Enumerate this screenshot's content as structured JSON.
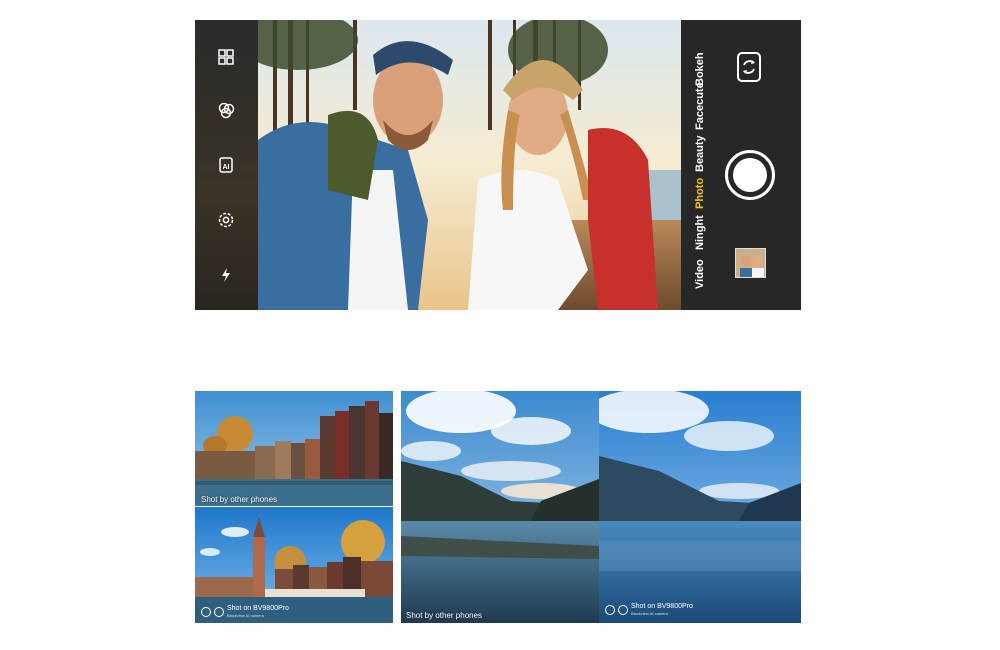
{
  "camera": {
    "modes": [
      "Video",
      "Ninght",
      "Photo",
      "Beauty",
      "Facecute",
      "Bokeh"
    ],
    "active_mode": "Photo",
    "left_icons": [
      "grid-icon",
      "filter-icon",
      "ai-icon",
      "settings-icon",
      "flash-icon"
    ],
    "switch_icon": "switch-camera-icon",
    "accent_color": "#f5c518"
  },
  "comparison": {
    "city_top_caption": "Shot by other phones",
    "city_bottom_watermark": "Shot on BV9800Pro",
    "city_bottom_watermark_sub": "Blackview AI camera",
    "lake_left_caption": "Shot by other phones",
    "lake_right_watermark": "Shot on BV9800Pro",
    "lake_right_watermark_sub": "Blackview AI camera"
  }
}
